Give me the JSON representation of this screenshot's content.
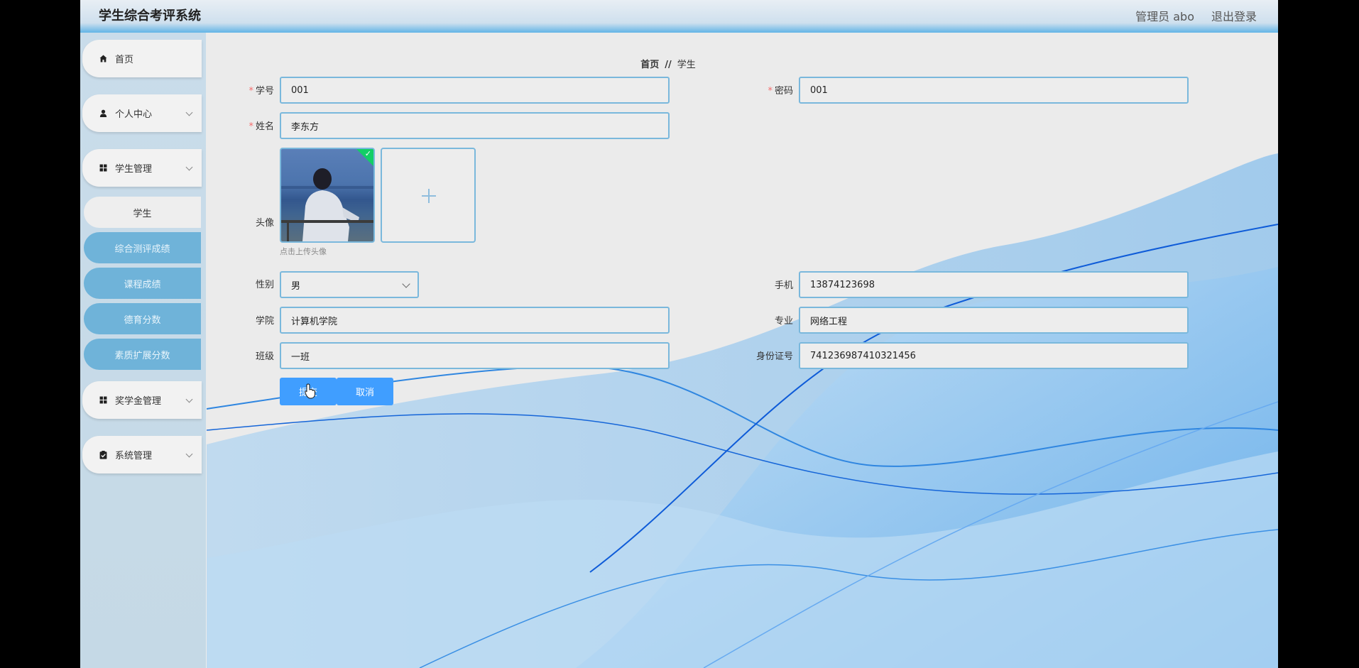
{
  "header": {
    "title": "学生综合考评系统",
    "admin": "管理员 abo",
    "logout": "退出登录"
  },
  "sidebar": {
    "items": [
      {
        "label": "首页",
        "icon": "home-icon"
      },
      {
        "label": "个人中心",
        "icon": "user-icon"
      },
      {
        "label": "学生管理",
        "icon": "grid-icon"
      },
      {
        "label": "奖学金管理",
        "icon": "grid-icon"
      },
      {
        "label": "系统管理",
        "icon": "clipboard-icon"
      }
    ],
    "sub_items": [
      "学生",
      "综合测评成绩",
      "课程成绩",
      "德育分数",
      "素质扩展分数"
    ]
  },
  "breadcrumb": {
    "home": "首页",
    "sep": "//",
    "current": "学生"
  },
  "form": {
    "student_no": {
      "label": "学号",
      "value": "001"
    },
    "password": {
      "label": "密码",
      "value": "001"
    },
    "name": {
      "label": "姓名",
      "value": "李东方"
    },
    "avatar": {
      "label": "头像",
      "tip": "点击上传头像"
    },
    "gender": {
      "label": "性别",
      "value": "男"
    },
    "phone": {
      "label": "手机",
      "value": "13874123698"
    },
    "college": {
      "label": "学院",
      "value": "计算机学院"
    },
    "major": {
      "label": "专业",
      "value": "网络工程"
    },
    "class": {
      "label": "班级",
      "value": "一班"
    },
    "id_card": {
      "label": "身份证号",
      "value": "741236987410321456"
    },
    "submit": "提交",
    "cancel": "取消"
  },
  "colors": {
    "accent": "#409eff",
    "border": "#7ab8dc",
    "sidebar_sub": "#6fb3d9",
    "required": "#f56c6c"
  }
}
